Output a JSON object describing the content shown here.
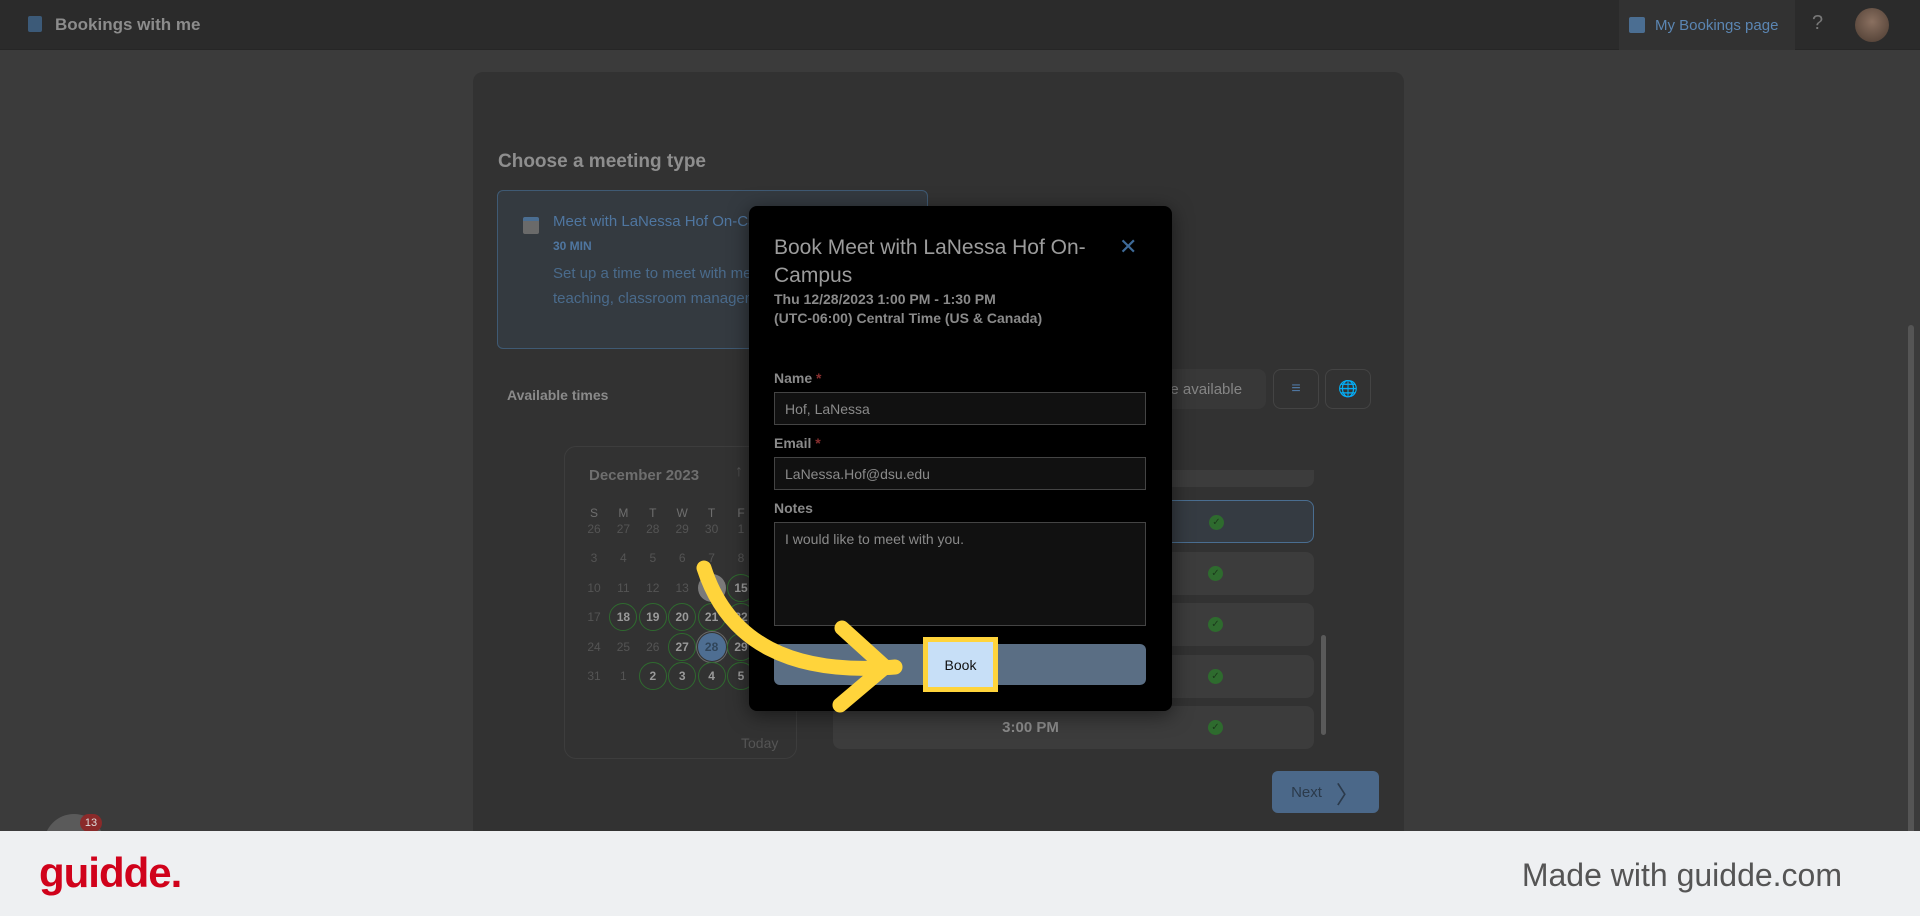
{
  "header": {
    "title": "Bookings with me",
    "my_bookings": "My Bookings page",
    "help": "?"
  },
  "main": {
    "choose_label": "Choose a meeting type",
    "meeting": {
      "title": "Meet with LaNessa Hof On-Campus",
      "duration": "30 MIN",
      "description": "Set up a time to meet with me to discuss documenting teaching, classroom management, research-based"
    },
    "available_times": "Available times",
    "calendar": {
      "month": "December 2023",
      "today_label": "Today",
      "dow": [
        "S",
        "M",
        "T",
        "W",
        "T",
        "F"
      ],
      "weeks": [
        [
          26,
          27,
          28,
          29,
          30,
          1
        ],
        [
          3,
          4,
          5,
          6,
          7,
          8
        ],
        [
          10,
          11,
          12,
          13,
          14,
          15
        ],
        [
          17,
          18,
          19,
          20,
          21,
          22
        ],
        [
          24,
          25,
          26,
          27,
          28,
          29
        ],
        [
          31,
          1,
          2,
          3,
          4,
          5
        ]
      ],
      "available": [
        "3-1",
        "3-2",
        "3-3",
        "3-4",
        "3-5",
        "2-5",
        "4-3",
        "4-5",
        "5-2",
        "5-3",
        "5-4",
        "5-5"
      ],
      "today": "2-4",
      "selected": "4-4"
    },
    "availability_pill": "are available",
    "slots": [
      {
        "time": "",
        "selected": true
      },
      {
        "time": ""
      },
      {
        "time": ""
      },
      {
        "time": ""
      },
      {
        "time": "3:00 PM"
      }
    ],
    "next": "Next"
  },
  "modal": {
    "title": "Book Meet with LaNessa Hof On-Campus",
    "date": "Thu 12/28/2023 1:00 PM - 1:30 PM",
    "timezone": "(UTC-06:00) Central Time (US & Canada)",
    "name_label": "Name",
    "name_value": "Hof, LaNessa",
    "email_label": "Email",
    "email_value": "LaNessa.Hof@dsu.edu",
    "notes_label": "Notes",
    "notes_value": "I would like to meet with you.",
    "required": "*",
    "book": "Book"
  },
  "notification_count": "13",
  "footer": {
    "logo": "guidde.",
    "made_with": "Made with guidde.com"
  },
  "colors": {
    "accent": "#4f76a0",
    "highlight": "#ffd43b",
    "brand_red": "#d0021b",
    "available": "#2f6a2f"
  }
}
